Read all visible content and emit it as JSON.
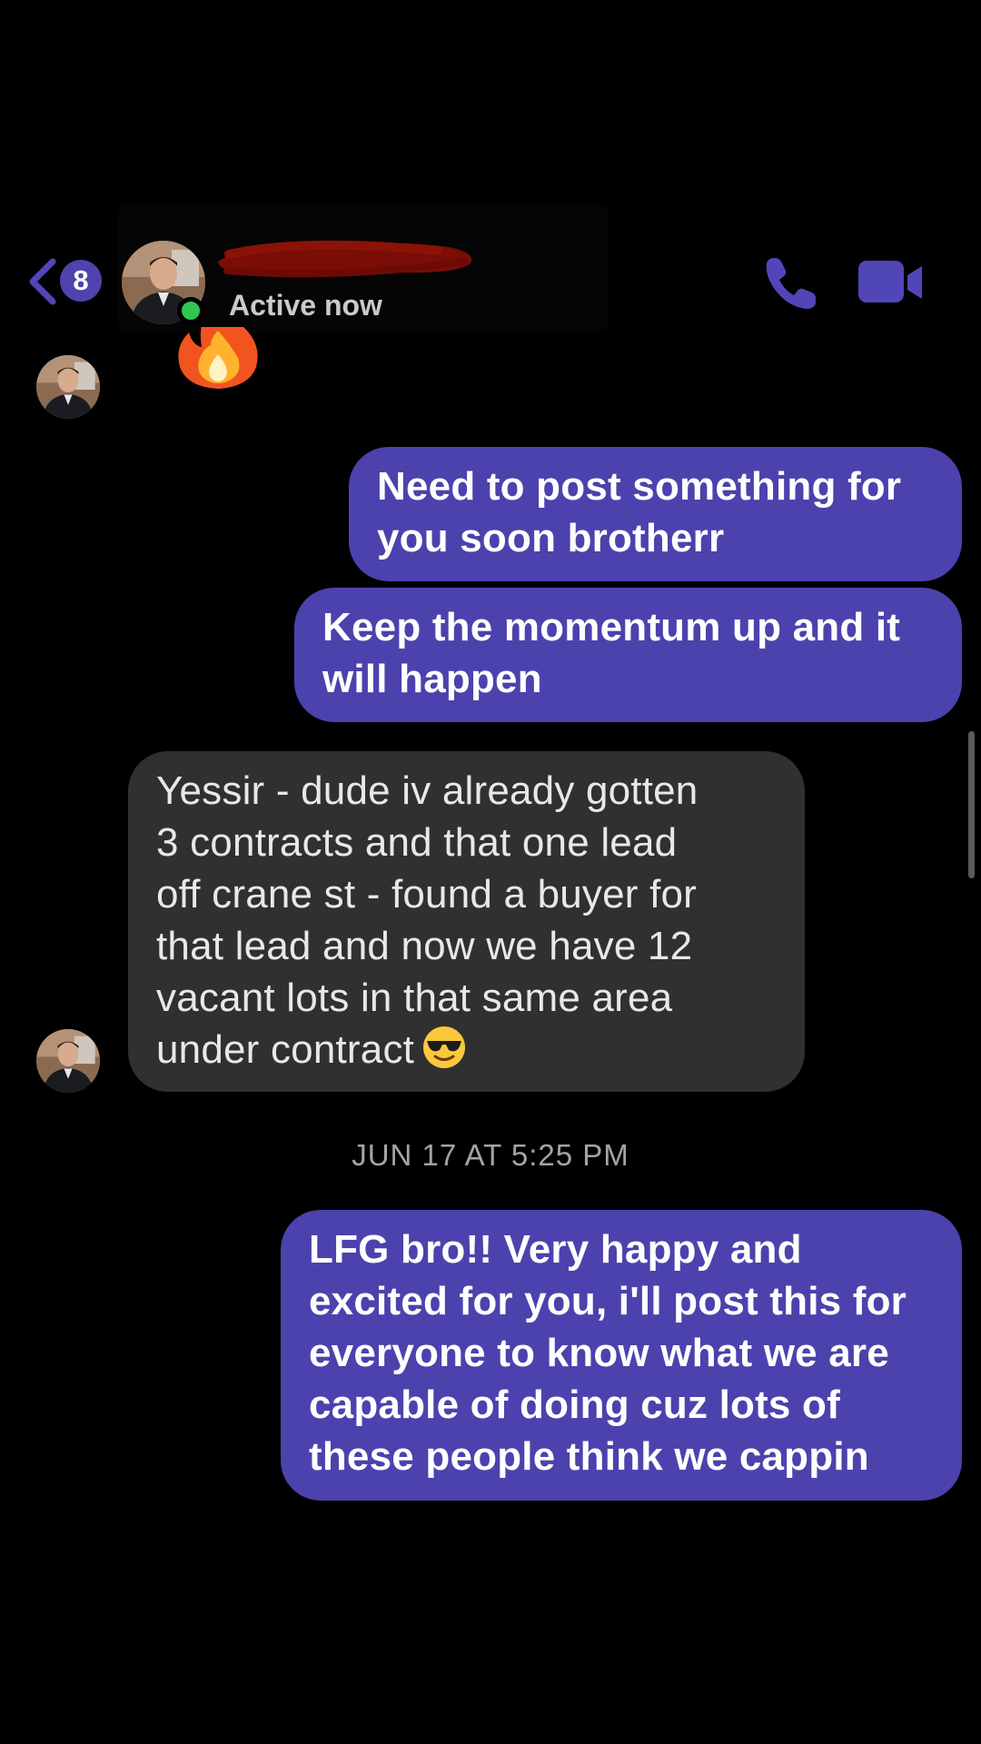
{
  "header": {
    "back_badge_count": "8",
    "contact_status": "Active now",
    "icons": {
      "back": "chevron-left-icon",
      "call": "phone-icon",
      "video": "video-camera-icon"
    }
  },
  "reaction": {
    "emoji_name": "fire-icon"
  },
  "messages": [
    {
      "direction": "outgoing",
      "text": "Need to post something for\nyou soon brotherr"
    },
    {
      "direction": "outgoing",
      "text": "Keep the momentum up and it\nwill happen"
    },
    {
      "direction": "incoming",
      "text": "Yessir - dude iv already gotten\n3 contracts and that one lead\noff crane st - found a buyer for\nthat lead and now we have 12\nvacant lots in that same area\nunder contract",
      "emoji": "sunglasses-face-icon"
    },
    {
      "direction": "outgoing",
      "text": "LFG bro!! Very happy and\nexcited for you, i'll post this for\neveryone to know what we are\ncapable of doing cuz lots of\nthese people think we cappin"
    }
  ],
  "timestamp": "JUN 17 AT 5:25 PM",
  "colors": {
    "background": "#000000",
    "outgoing_bubble": "#4c42ad",
    "incoming_bubble": "#303033",
    "accent": "#5146b8",
    "active_dot": "#31c552"
  }
}
